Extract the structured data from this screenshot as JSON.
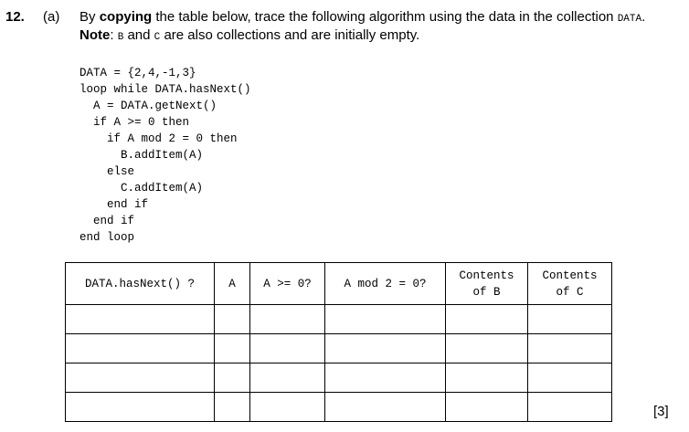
{
  "question": {
    "number": "12.",
    "part": "(a)",
    "text_1": "By ",
    "text_bold_1": "copying",
    "text_2": " the table below, trace the following algorithm using the data in the collection ",
    "collection_name": "DATA",
    "text_3": ". ",
    "note_label": "Note",
    "text_4": ": ",
    "collection_b": "B",
    "text_5": " and ",
    "collection_c": "C",
    "text_6": " are also collections and are initially empty."
  },
  "code_lines": [
    "DATA = {2,4,-1,3}",
    "loop while DATA.hasNext()",
    "  A = DATA.getNext()",
    "  if A >= 0 then",
    "    if A mod 2 = 0 then",
    "      B.addItem(A)",
    "    else",
    "      C.addItem(A)",
    "    end if",
    "  end if",
    "end loop"
  ],
  "table": {
    "headers": [
      [
        "DATA.hasNext() ?"
      ],
      [
        "A"
      ],
      [
        "A >= 0?"
      ],
      [
        "A mod 2 = 0?"
      ],
      [
        "Contents",
        "of B"
      ],
      [
        "Contents",
        "of C"
      ]
    ],
    "empty_rows": 4
  },
  "marks": "[3]"
}
